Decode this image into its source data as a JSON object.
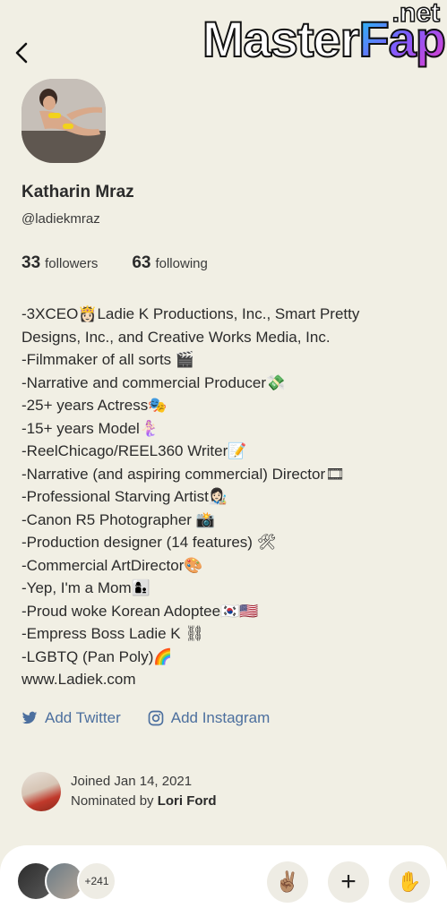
{
  "header": {
    "watermark_main": "Master",
    "watermark_accent": "Fap",
    "watermark_tld": ".net"
  },
  "profile": {
    "name": "Katharin Mraz",
    "handle": "@ladiekmraz",
    "followers_count": "33",
    "followers_label": "followers",
    "following_count": "63",
    "following_label": "following"
  },
  "bio": [
    "-3XCEO👸🏻Ladie K Productions, Inc., Smart Pretty",
    "Designs, Inc., and Creative Works Media, Inc.",
    "-Filmmaker of all sorts 🎬",
    "-Narrative and commercial Producer💸",
    "-25+ years Actress🎭",
    "-15+ years Model🧜🏻‍♀️",
    "-ReelChicago/REEL360 Writer📝",
    "-Narrative (and aspiring commercial) Director🎞",
    "-Professional Starving Artist👩🏻‍🎨",
    "-Canon R5 Photographer 📸",
    "-Production designer (14 features) 🛠",
    "-Commercial ArtDirector🎨",
    "-Yep, I'm a Mom👩‍👦",
    "-Proud woke Korean Adoptee🇰🇷🇺🇸",
    "-Empress Boss Ladie K ⛓",
    "-LGBTQ (Pan Poly)🌈",
    "www.Ladiek.com"
  ],
  "social": {
    "twitter_label": "Add Twitter",
    "instagram_label": "Add Instagram"
  },
  "joined": {
    "joined_text": "Joined Jan 14, 2021",
    "nominated_prefix": "Nominated by",
    "nominator": "Lori Ford"
  },
  "bottom": {
    "listener_count": "+241",
    "wave_icon": "✌🏽",
    "add_icon": "+",
    "hand_icon": "✋"
  },
  "colors": {
    "background": "#f1efe4",
    "link": "#4c6f9e",
    "text": "#2b2b2b"
  }
}
